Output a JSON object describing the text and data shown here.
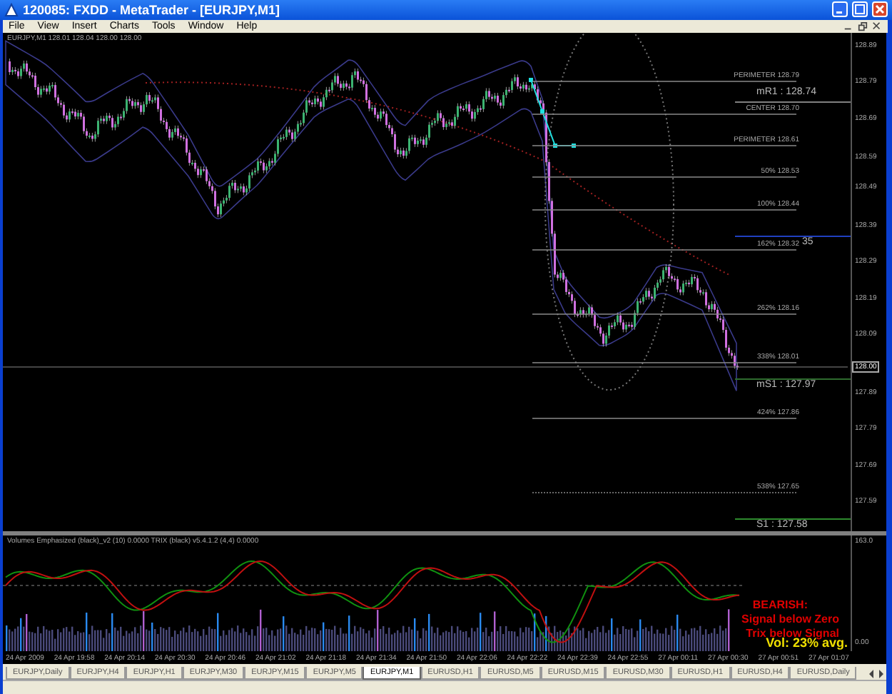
{
  "window": {
    "title": "120085: FXDD - MetaTrader - [EURJPY,M1]"
  },
  "menu": [
    "File",
    "View",
    "Insert",
    "Charts",
    "Tools",
    "Window",
    "Help"
  ],
  "chart": {
    "label": "EURJPY,M1  128.01 128.04 128.00 128.00",
    "price_axis": [
      {
        "text": "128.89",
        "kind": "tick"
      },
      {
        "text": "128.79",
        "kind": "tick"
      },
      {
        "text": "128.69",
        "kind": "tick"
      },
      {
        "text": "128.59",
        "kind": "tick"
      },
      {
        "text": "128.49",
        "kind": "tick"
      },
      {
        "text": "128.39",
        "kind": "tick"
      },
      {
        "text": "128.29",
        "kind": "tick"
      },
      {
        "text": "128.19",
        "kind": "tick"
      },
      {
        "text": "128.09",
        "kind": "tick"
      },
      {
        "text": "128.00",
        "kind": "current"
      },
      {
        "text": "127.89",
        "kind": "tick"
      },
      {
        "text": "127.79",
        "kind": "tick"
      },
      {
        "text": "127.69",
        "kind": "tick"
      },
      {
        "text": "127.59",
        "kind": "tick"
      }
    ],
    "levels": [
      {
        "kind": "fib",
        "text": "PERIMETER   128.79"
      },
      {
        "kind": "pivot",
        "text": "mR1 : 128.74",
        "color": "#808080"
      },
      {
        "kind": "fib",
        "text": "CENTER   128.70"
      },
      {
        "kind": "fib",
        "text": "PERIMETER   128.61"
      },
      {
        "kind": "fib",
        "text": "50%   128.53"
      },
      {
        "kind": "fib",
        "text": "100%   128.44"
      },
      {
        "kind": "fib",
        "text": "162%   128.32"
      },
      {
        "kind": "pivot",
        "text": "35",
        "color": "#2040c0"
      },
      {
        "kind": "fib",
        "text": "262%   128.16"
      },
      {
        "kind": "fib",
        "text": "338%   128.01"
      },
      {
        "kind": "pivot",
        "text": "mS1 : 127.97",
        "color": "#2e6b2e"
      },
      {
        "kind": "fib",
        "text": "424%   127.86"
      },
      {
        "kind": "fib",
        "text": "538%   127.65"
      },
      {
        "kind": "pivot",
        "text": "S1 : 127.58",
        "color": "#2e8b2e"
      }
    ]
  },
  "indicator": {
    "label": "Volumes Emphasized (black)_v2 (10)  0.0000     TRIX (black) v5.4.1.2 (4,4)  0.0000",
    "axis": [
      "163.0",
      "0.00"
    ],
    "signal": [
      "BEARISH:",
      "Signal below Zero",
      "Trix below Signal"
    ],
    "volume": "Vol:  23% avg."
  },
  "time_axis": [
    "24 Apr 2009",
    "24 Apr 19:58",
    "24 Apr 20:14",
    "24 Apr 20:30",
    "24 Apr 20:46",
    "24 Apr 21:02",
    "24 Apr 21:18",
    "24 Apr 21:34",
    "24 Apr 21:50",
    "24 Apr 22:06",
    "24 Apr 22:22",
    "24 Apr 22:39",
    "24 Apr 22:55",
    "27 Apr 00:11",
    "27 Apr 00:30",
    "27 Apr 00:51",
    "27 Apr 01:07"
  ],
  "tabs": [
    {
      "label": "EURJPY,Daily",
      "selected": false
    },
    {
      "label": "EURJPY,H4",
      "selected": false
    },
    {
      "label": "EURJPY,H1",
      "selected": false
    },
    {
      "label": "EURJPY,M30",
      "selected": false
    },
    {
      "label": "EURJPY,M15",
      "selected": false
    },
    {
      "label": "EURJPY,M5",
      "selected": false
    },
    {
      "label": "EURJPY,M1",
      "selected": true
    },
    {
      "label": "EURUSD,H1",
      "selected": false
    },
    {
      "label": "EURUSD,M5",
      "selected": false
    },
    {
      "label": "EURUSD,M15",
      "selected": false
    },
    {
      "label": "EURUSD,M30",
      "selected": false
    },
    {
      "label": "EURUSD,H1",
      "selected": false
    },
    {
      "label": "EURUSD,H4",
      "selected": false
    },
    {
      "label": "EURUSD,Daily",
      "selected": false
    }
  ]
}
